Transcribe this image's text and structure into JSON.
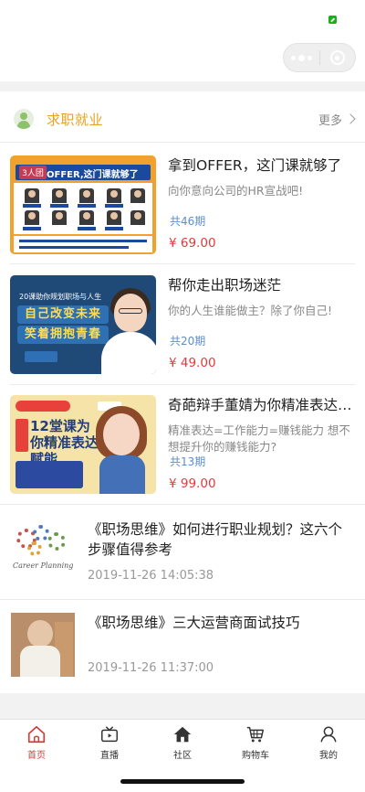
{
  "status_bar": {
    "battery_color": "#1aad19"
  },
  "capsule": {
    "more_icon": "more-dots-icon",
    "close_icon": "capsule-close-icon"
  },
  "section": {
    "title": "求职就业",
    "more_label": "更多",
    "title_color": "#e7a324"
  },
  "courses": [
    {
      "title": "拿到OFFER，这门课就够了",
      "description": "向你意向公司的HR宣战吧!",
      "lessons": "共46期",
      "price": "¥ 69.00",
      "cover_tag": "3人团",
      "cover_banner": "OFFER,这门课就够了"
    },
    {
      "title": "帮你走出职场迷茫",
      "description": "你的人生谁能做主？除了你自己!",
      "lessons": "共20期",
      "price": "¥ 49.00",
      "cover_line": "20课助你规划职场与人生",
      "cover_line1": "自己改变未来",
      "cover_line2": "笑着拥抱青春"
    },
    {
      "title": "奇葩辩手董婧为你精准表达…",
      "description": "精准表达=工作能力=赚钱能力 想不想提升你的赚钱能力?",
      "lessons": "共13期",
      "price": "¥ 99.00",
      "cover_big": "12堂课为你精准表达赋能"
    }
  ],
  "articles": [
    {
      "title": "《职场思维》如何进行职业规划？这六个步骤值得参考",
      "time": "2019-11-26 14:05:38",
      "thumb_caption": "Career Planning"
    },
    {
      "title": "《职场思维》三大运营商面试技巧",
      "time": "2019-11-26 11:37:00"
    }
  ],
  "tabs": [
    {
      "label": "首页",
      "icon": "home-icon",
      "active": true
    },
    {
      "label": "直播",
      "icon": "tv-icon",
      "active": false
    },
    {
      "label": "社区",
      "icon": "community-icon",
      "active": false
    },
    {
      "label": "购物车",
      "icon": "cart-icon",
      "active": false
    },
    {
      "label": "我的",
      "icon": "profile-icon",
      "active": false
    }
  ],
  "colors": {
    "accent": "#d43b3b",
    "price": "#e4393c",
    "lessons": "#5c8fce"
  }
}
